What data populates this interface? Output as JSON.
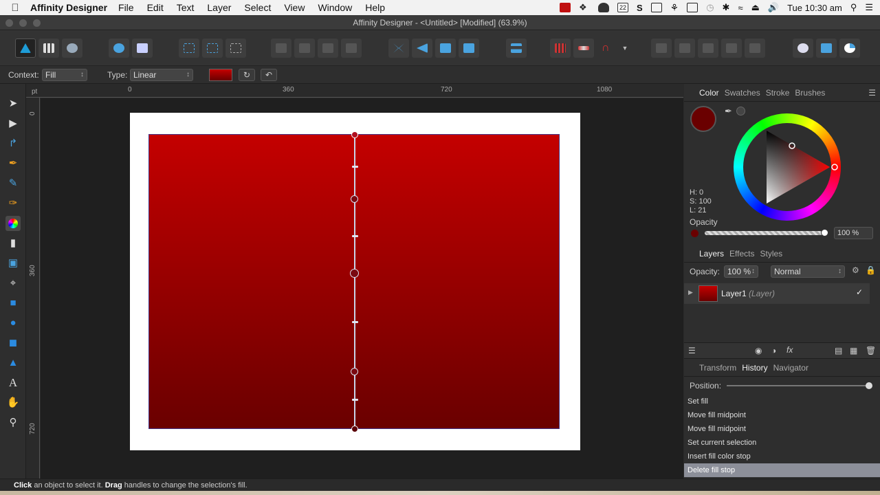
{
  "menubar": {
    "app_name": "Affinity Designer",
    "items": [
      "File",
      "Edit",
      "Text",
      "Layer",
      "Select",
      "View",
      "Window",
      "Help"
    ],
    "calendar_day": "22",
    "clock": "Tue 10:30 am"
  },
  "window": {
    "title": "Affinity Designer - <Untitled> [Modified] (63.9%)"
  },
  "contextbar": {
    "context_label": "Context:",
    "context_value": "Fill",
    "type_label": "Type:",
    "type_value": "Linear"
  },
  "rulers": {
    "unit": "pt",
    "top_labels": [
      "0",
      "360",
      "720",
      "1080"
    ],
    "left_labels": [
      "0",
      "360",
      "720"
    ]
  },
  "fill": {
    "start_color": "#c40000",
    "end_color": "#6a0000"
  },
  "color_panel": {
    "tabs": [
      "Color",
      "Swatches",
      "Stroke",
      "Brushes"
    ],
    "active_tab": "Color",
    "swatch_color": "#6a0000",
    "h": "H: 0",
    "s": "S: 100",
    "l": "L: 21",
    "opacity_label": "Opacity",
    "opacity_value": "100 %"
  },
  "layers_panel": {
    "tabs": [
      "Layers",
      "Effects",
      "Styles"
    ],
    "opacity_label": "Opacity:",
    "opacity_value": "100 %",
    "blend_mode": "Normal",
    "layer_name": "Layer1",
    "layer_type": "(Layer)"
  },
  "history_panel": {
    "tabs": [
      "Transform",
      "History",
      "Navigator"
    ],
    "position_label": "Position:",
    "items": [
      "Set fill",
      "Move fill midpoint",
      "Move fill midpoint",
      "Set current selection",
      "Insert fill color stop",
      "Delete fill stop"
    ]
  },
  "status": {
    "click": "Click",
    "text1": " an object to select it. ",
    "drag": "Drag",
    "text2": " handles to change the selection's fill."
  },
  "accent_color": "#1e9cd7"
}
